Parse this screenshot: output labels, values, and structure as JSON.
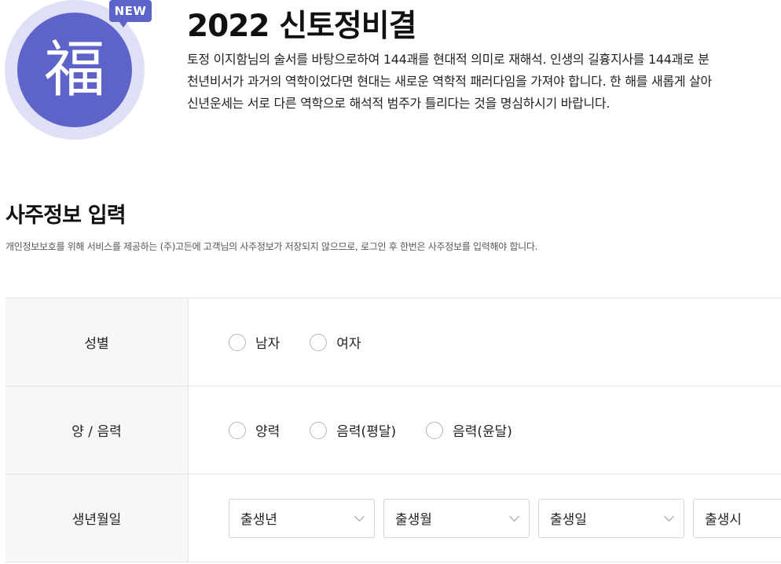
{
  "product": {
    "logo_char": "福",
    "badge": "NEW",
    "title": "2022 신토정비결",
    "description": [
      "토정 이지함님의 술서를 바탕으로하여 144괘를 현대적 의미로 재해석. 인생의 길흉지사를 144괘로 분",
      "천년비서가 과거의 역학이었다면 현대는 새로운 역학적 패러다임을 가져야 합니다. 한 해를 새롭게 살아",
      "신년운세는 서로 다른 역학으로 해석적 범주가 틀리다는 것을 명심하시기 바랍니다."
    ],
    "colors": {
      "accent": "#5d63c9",
      "ring": "#dfe0f6"
    }
  },
  "saju": {
    "title": "사주정보 입력",
    "notice": "개인정보보호를 위해 서비스를 제공하는 (주)고든에 고객님의 사주정보가 저장되지 않으므로, 로그인 후 한번은 사주정보를 입력해야 합니다.",
    "gender": {
      "label": "성별",
      "options": [
        "남자",
        "여자"
      ]
    },
    "calendar": {
      "label": "양 / 음력",
      "options": [
        "양력",
        "음력(평달)",
        "음력(윤달)"
      ]
    },
    "birth": {
      "label": "생년월일",
      "selects": [
        "출생년",
        "출생월",
        "출생일",
        "출생시"
      ]
    }
  }
}
